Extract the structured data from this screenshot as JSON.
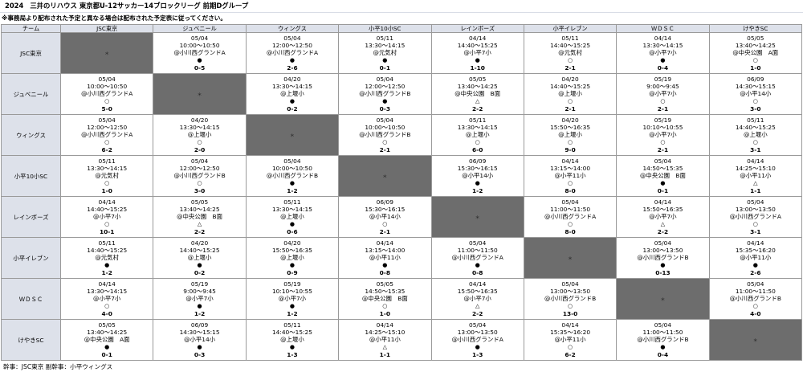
{
  "title": {
    "year": "2024",
    "sponsor": "三井のリハウス 東京都U-12サッカー14ブロックリーグ 前期Dグループ"
  },
  "notice": "※事務局より配布された予定と異なる場合は配布された予定表に従ってください。",
  "header": {
    "corner": "チーム",
    "teams": [
      "JSC東京",
      "ジュベニール",
      "ウィングス",
      "小平10小SC",
      "レインボーズ",
      "小平イレブン",
      "ＷＤＳＣ",
      "けやきSC"
    ]
  },
  "self_mark": "＊",
  "rows": [
    {
      "team": "JSC東京",
      "cells": [
        null,
        {
          "date": "05/04",
          "time": "10:00～10:50",
          "venue": "@小川西グランドA",
          "result": "●",
          "score": "0-5"
        },
        {
          "date": "05/04",
          "time": "12:00～12:50",
          "venue": "@小川西グランドA",
          "result": "●",
          "score": "2-6"
        },
        {
          "date": "05/11",
          "time": "13:30～14:15",
          "venue": "@元気村",
          "result": "●",
          "score": "0-1"
        },
        {
          "date": "04/14",
          "time": "14:40～15:25",
          "venue": "@小平7小",
          "result": "●",
          "score": "1-10"
        },
        {
          "date": "05/11",
          "time": "14:40～15:25",
          "venue": "@元気村",
          "result": "○",
          "score": "2-1"
        },
        {
          "date": "04/14",
          "time": "13:30～14:15",
          "venue": "@小平7小",
          "result": "●",
          "score": "0-4"
        },
        {
          "date": "05/05",
          "time": "13:40～14:25",
          "venue": "@中央公園　A面",
          "result": "○",
          "score": "1-0"
        }
      ]
    },
    {
      "team": "ジュベニール",
      "cells": [
        {
          "date": "05/04",
          "time": "10:00～10:50",
          "venue": "@小川西グランドA",
          "result": "○",
          "score": "5-0"
        },
        null,
        {
          "date": "04/20",
          "time": "13:30～14:15",
          "venue": "@上堰小",
          "result": "●",
          "score": "0-2"
        },
        {
          "date": "05/04",
          "time": "12:00～12:50",
          "venue": "@小川西グランドB",
          "result": "●",
          "score": "0-3"
        },
        {
          "date": "05/05",
          "time": "13:40～14:25",
          "venue": "@中央公園　B面",
          "result": "△",
          "score": "2-2"
        },
        {
          "date": "04/20",
          "time": "14:40～15:25",
          "venue": "@上堰小",
          "result": "○",
          "score": "2-1"
        },
        {
          "date": "05/19",
          "time": "9:00～9:45",
          "venue": "@小平7小",
          "result": "○",
          "score": "2-1"
        },
        {
          "date": "06/09",
          "time": "14:30～15:15",
          "venue": "@小平14小",
          "result": "○",
          "score": "3-0"
        }
      ]
    },
    {
      "team": "ウィングス",
      "cells": [
        {
          "date": "05/04",
          "time": "12:00～12:50",
          "venue": "@小川西グランドA",
          "result": "○",
          "score": "6-2"
        },
        {
          "date": "04/20",
          "time": "13:30～14:15",
          "venue": "@上堰小",
          "result": "○",
          "score": "2-0"
        },
        null,
        {
          "date": "05/04",
          "time": "10:00～10:50",
          "venue": "@小川西グランドB",
          "result": "○",
          "score": "2-1"
        },
        {
          "date": "05/11",
          "time": "13:30～14:15",
          "venue": "@上堰小",
          "result": "○",
          "score": "6-0"
        },
        {
          "date": "04/20",
          "time": "15:50～16:35",
          "venue": "@上堰小",
          "result": "○",
          "score": "9-0"
        },
        {
          "date": "05/19",
          "time": "10:10～10:55",
          "venue": "@小平7小",
          "result": "○",
          "score": "2-1"
        },
        {
          "date": "05/11",
          "time": "14:40～15:25",
          "venue": "@上堰小",
          "result": "○",
          "score": "3-1"
        }
      ]
    },
    {
      "team": "小平10小SC",
      "cells": [
        {
          "date": "05/11",
          "time": "13:30～14:15",
          "venue": "@元気村",
          "result": "○",
          "score": "1-0"
        },
        {
          "date": "05/04",
          "time": "12:00～12:50",
          "venue": "@小川西グランドB",
          "result": "○",
          "score": "3-0"
        },
        {
          "date": "05/04",
          "time": "10:00～10:50",
          "venue": "@小川西グランドB",
          "result": "●",
          "score": "1-2"
        },
        null,
        {
          "date": "06/09",
          "time": "15:30～16:15",
          "venue": "@小平14小",
          "result": "●",
          "score": "1-2"
        },
        {
          "date": "04/14",
          "time": "13:15～14:00",
          "venue": "@小平11小",
          "result": "○",
          "score": "8-0"
        },
        {
          "date": "05/04",
          "time": "14:50～15:35",
          "venue": "@中央公園　B面",
          "result": "●",
          "score": "0-1"
        },
        {
          "date": "04/14",
          "time": "14:25～15:10",
          "venue": "@小平11小",
          "result": "△",
          "score": "1-1"
        }
      ]
    },
    {
      "team": "レインボーズ",
      "cells": [
        {
          "date": "04/14",
          "time": "14:40～15:25",
          "venue": "@小平7小",
          "result": "○",
          "score": "10-1"
        },
        {
          "date": "05/05",
          "time": "13:40～14:25",
          "venue": "@中央公園　B面",
          "result": "△",
          "score": "2-2"
        },
        {
          "date": "05/11",
          "time": "13:30～14:15",
          "venue": "@上堰小",
          "result": "●",
          "score": "0-6"
        },
        {
          "date": "06/09",
          "time": "15:30～16:15",
          "venue": "@小平14小",
          "result": "○",
          "score": "2-1"
        },
        null,
        {
          "date": "05/04",
          "time": "11:00～11:50",
          "venue": "@小川西グランドA",
          "result": "○",
          "score": "8-0"
        },
        {
          "date": "04/14",
          "time": "15:50～16:35",
          "venue": "@小平7小",
          "result": "△",
          "score": "2-2"
        },
        {
          "date": "05/04",
          "time": "13:00～13:50",
          "venue": "@小川西グランドA",
          "result": "○",
          "score": "3-1"
        }
      ]
    },
    {
      "team": "小平イレブン",
      "cells": [
        {
          "date": "05/11",
          "time": "14:40～15:25",
          "venue": "@元気村",
          "result": "●",
          "score": "1-2"
        },
        {
          "date": "04/20",
          "time": "14:40～15:25",
          "venue": "@上堰小",
          "result": "●",
          "score": "0-2"
        },
        {
          "date": "04/20",
          "time": "15:50～16:35",
          "venue": "@上堰小",
          "result": "●",
          "score": "0-9"
        },
        {
          "date": "04/14",
          "time": "13:15～14:00",
          "venue": "@小平11小",
          "result": "●",
          "score": "0-8"
        },
        {
          "date": "05/04",
          "time": "11:00～11:50",
          "venue": "@小川西グランドA",
          "result": "●",
          "score": "0-8"
        },
        null,
        {
          "date": "05/04",
          "time": "13:00～13:50",
          "venue": "@小川西グランドB",
          "result": "●",
          "score": "0-13"
        },
        {
          "date": "04/14",
          "time": "15:35～16:20",
          "venue": "@小平11小",
          "result": "●",
          "score": "2-6"
        }
      ]
    },
    {
      "team": "ＷＤＳＣ",
      "cells": [
        {
          "date": "04/14",
          "time": "13:30～14:15",
          "venue": "@小平7小",
          "result": "○",
          "score": "4-0"
        },
        {
          "date": "05/19",
          "time": "9:00～9:45",
          "venue": "@小平7小",
          "result": "●",
          "score": "1-2"
        },
        {
          "date": "05/19",
          "time": "10:10～10:55",
          "venue": "@小平7小",
          "result": "●",
          "score": "1-2"
        },
        {
          "date": "05/05",
          "time": "14:50～15:35",
          "venue": "@中央公園　B面",
          "result": "○",
          "score": "1-0"
        },
        {
          "date": "04/14",
          "time": "15:50～16:35",
          "venue": "@小平7小",
          "result": "△",
          "score": "2-2"
        },
        {
          "date": "05/04",
          "time": "13:00～13:50",
          "venue": "@小川西グランドB",
          "result": "○",
          "score": "13-0"
        },
        null,
        {
          "date": "05/04",
          "time": "11:00～11:50",
          "venue": "@小川西グランドB",
          "result": "○",
          "score": "4-0"
        }
      ]
    },
    {
      "team": "けやきSC",
      "cells": [
        {
          "date": "05/05",
          "time": "13:40～14:25",
          "venue": "@中央公園　A面",
          "result": "●",
          "score": "0-1"
        },
        {
          "date": "06/09",
          "time": "14:30～15:15",
          "venue": "@小平14小",
          "result": "●",
          "score": "0-3"
        },
        {
          "date": "05/11",
          "time": "14:40～15:25",
          "venue": "@上堰小",
          "result": "●",
          "score": "1-3"
        },
        {
          "date": "04/14",
          "time": "14:25～15:10",
          "venue": "@小平11小",
          "result": "△",
          "score": "1-1"
        },
        {
          "date": "05/04",
          "time": "13:00～13:50",
          "venue": "@小川西グランドA",
          "result": "●",
          "score": "1-3"
        },
        {
          "date": "04/14",
          "time": "15:35～16:20",
          "venue": "@小平11小",
          "result": "○",
          "score": "6-2"
        },
        {
          "date": "05/04",
          "time": "11:00～11:50",
          "venue": "@小川西グランドB",
          "result": "●",
          "score": "0-4"
        },
        null
      ]
    }
  ],
  "footer": "幹事：JSC東京  副幹事：小平ウィングス"
}
